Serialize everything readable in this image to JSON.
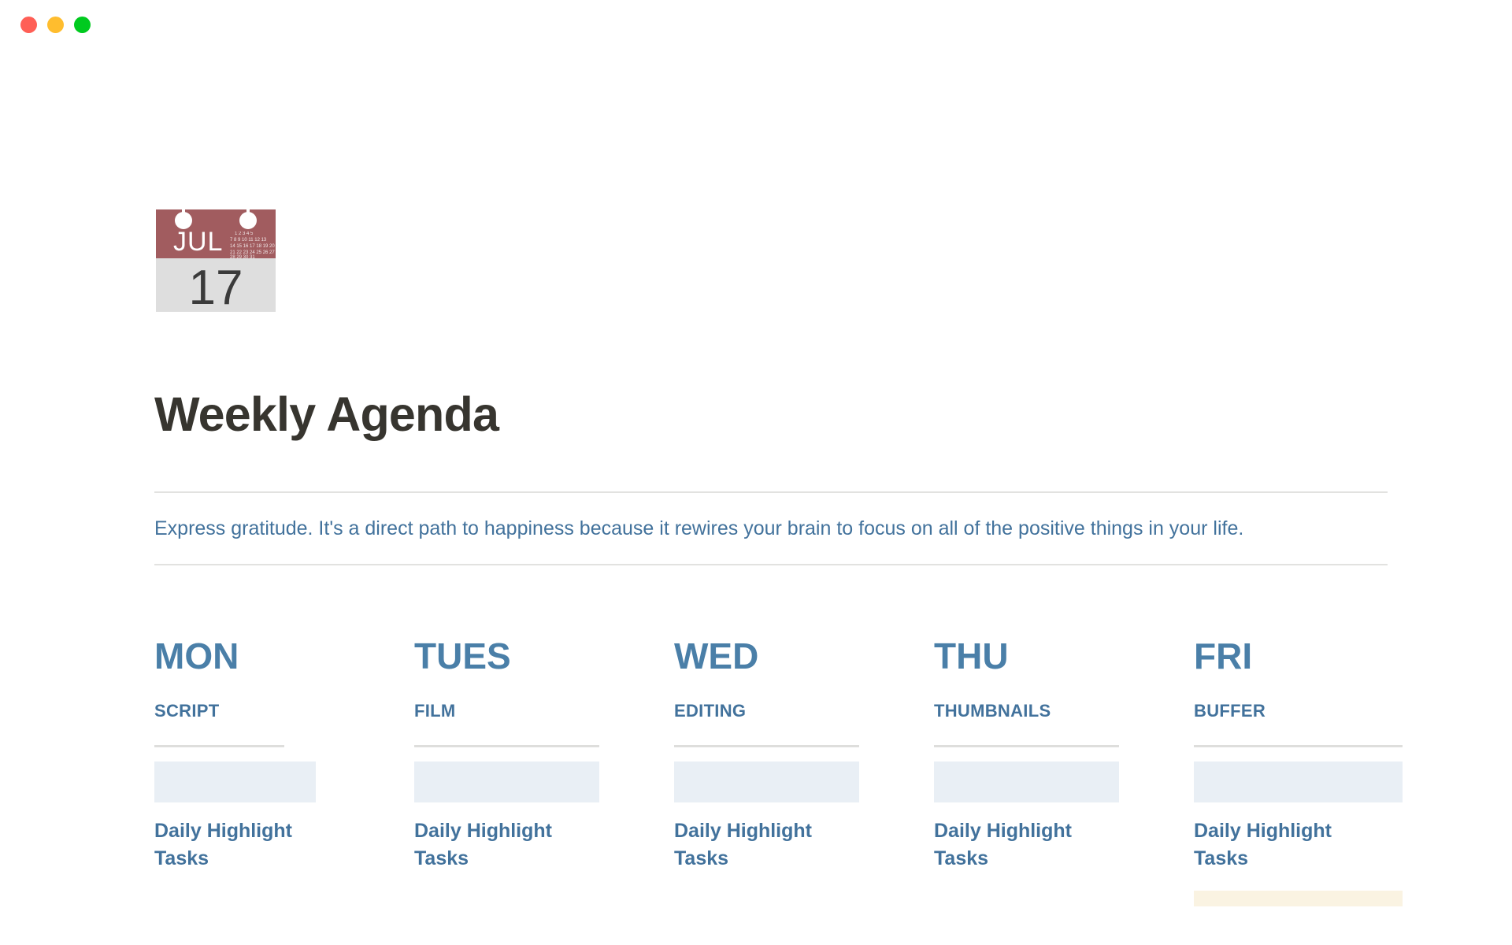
{
  "window": {
    "traffic_lights": [
      {
        "name": "close-button",
        "color": "#ff5f56"
      },
      {
        "name": "minimize-button",
        "color": "#ffbd2e"
      },
      {
        "name": "maximize-button",
        "color": "#00ca1f"
      }
    ]
  },
  "page": {
    "icon": {
      "name": "calendar-icon",
      "month": "JUL",
      "day": "17",
      "header_color": "#a15c5f",
      "body_color": "#dedede",
      "day_color": "#3b3b3b"
    },
    "title": "Weekly Agenda",
    "description": "Express gratitude. It's a direct path to happiness because it rewires your brain to focus on all of the positive things in your life.",
    "accent_color": "#4a7fa8",
    "text_color": "#37352f",
    "divider_color": "#e2e2e0",
    "placeholder_color": "#e9eff5",
    "highlight_color": "#faf3e2"
  },
  "week": {
    "columns": [
      {
        "day": "MON",
        "topic": "SCRIPT",
        "task_label": "Daily Highlight Tasks",
        "has_highlight": false
      },
      {
        "day": "TUES",
        "topic": "FILM",
        "task_label": "Daily Highlight Tasks",
        "has_highlight": false
      },
      {
        "day": "WED",
        "topic": "EDITING",
        "task_label": "Daily Highlight Tasks",
        "has_highlight": false
      },
      {
        "day": "THU",
        "topic": "THUMBNAILS",
        "task_label": "Daily Highlight Tasks",
        "has_highlight": false
      },
      {
        "day": "FRI",
        "topic": "BUFFER",
        "task_label": "Daily Highlight Tasks",
        "has_highlight": true
      }
    ]
  },
  "calendar_grid": {
    "row1": [
      "1",
      "2",
      "3",
      "4",
      "5"
    ],
    "row2": [
      "7",
      "8",
      "9",
      "10",
      "11",
      "12",
      "13"
    ],
    "row3": [
      "14",
      "15",
      "16",
      "17",
      "18",
      "19",
      "20"
    ],
    "row4": [
      "21",
      "22",
      "23",
      "24",
      "25",
      "26",
      "27"
    ],
    "row5": [
      "28",
      "29",
      "30",
      "31"
    ]
  }
}
